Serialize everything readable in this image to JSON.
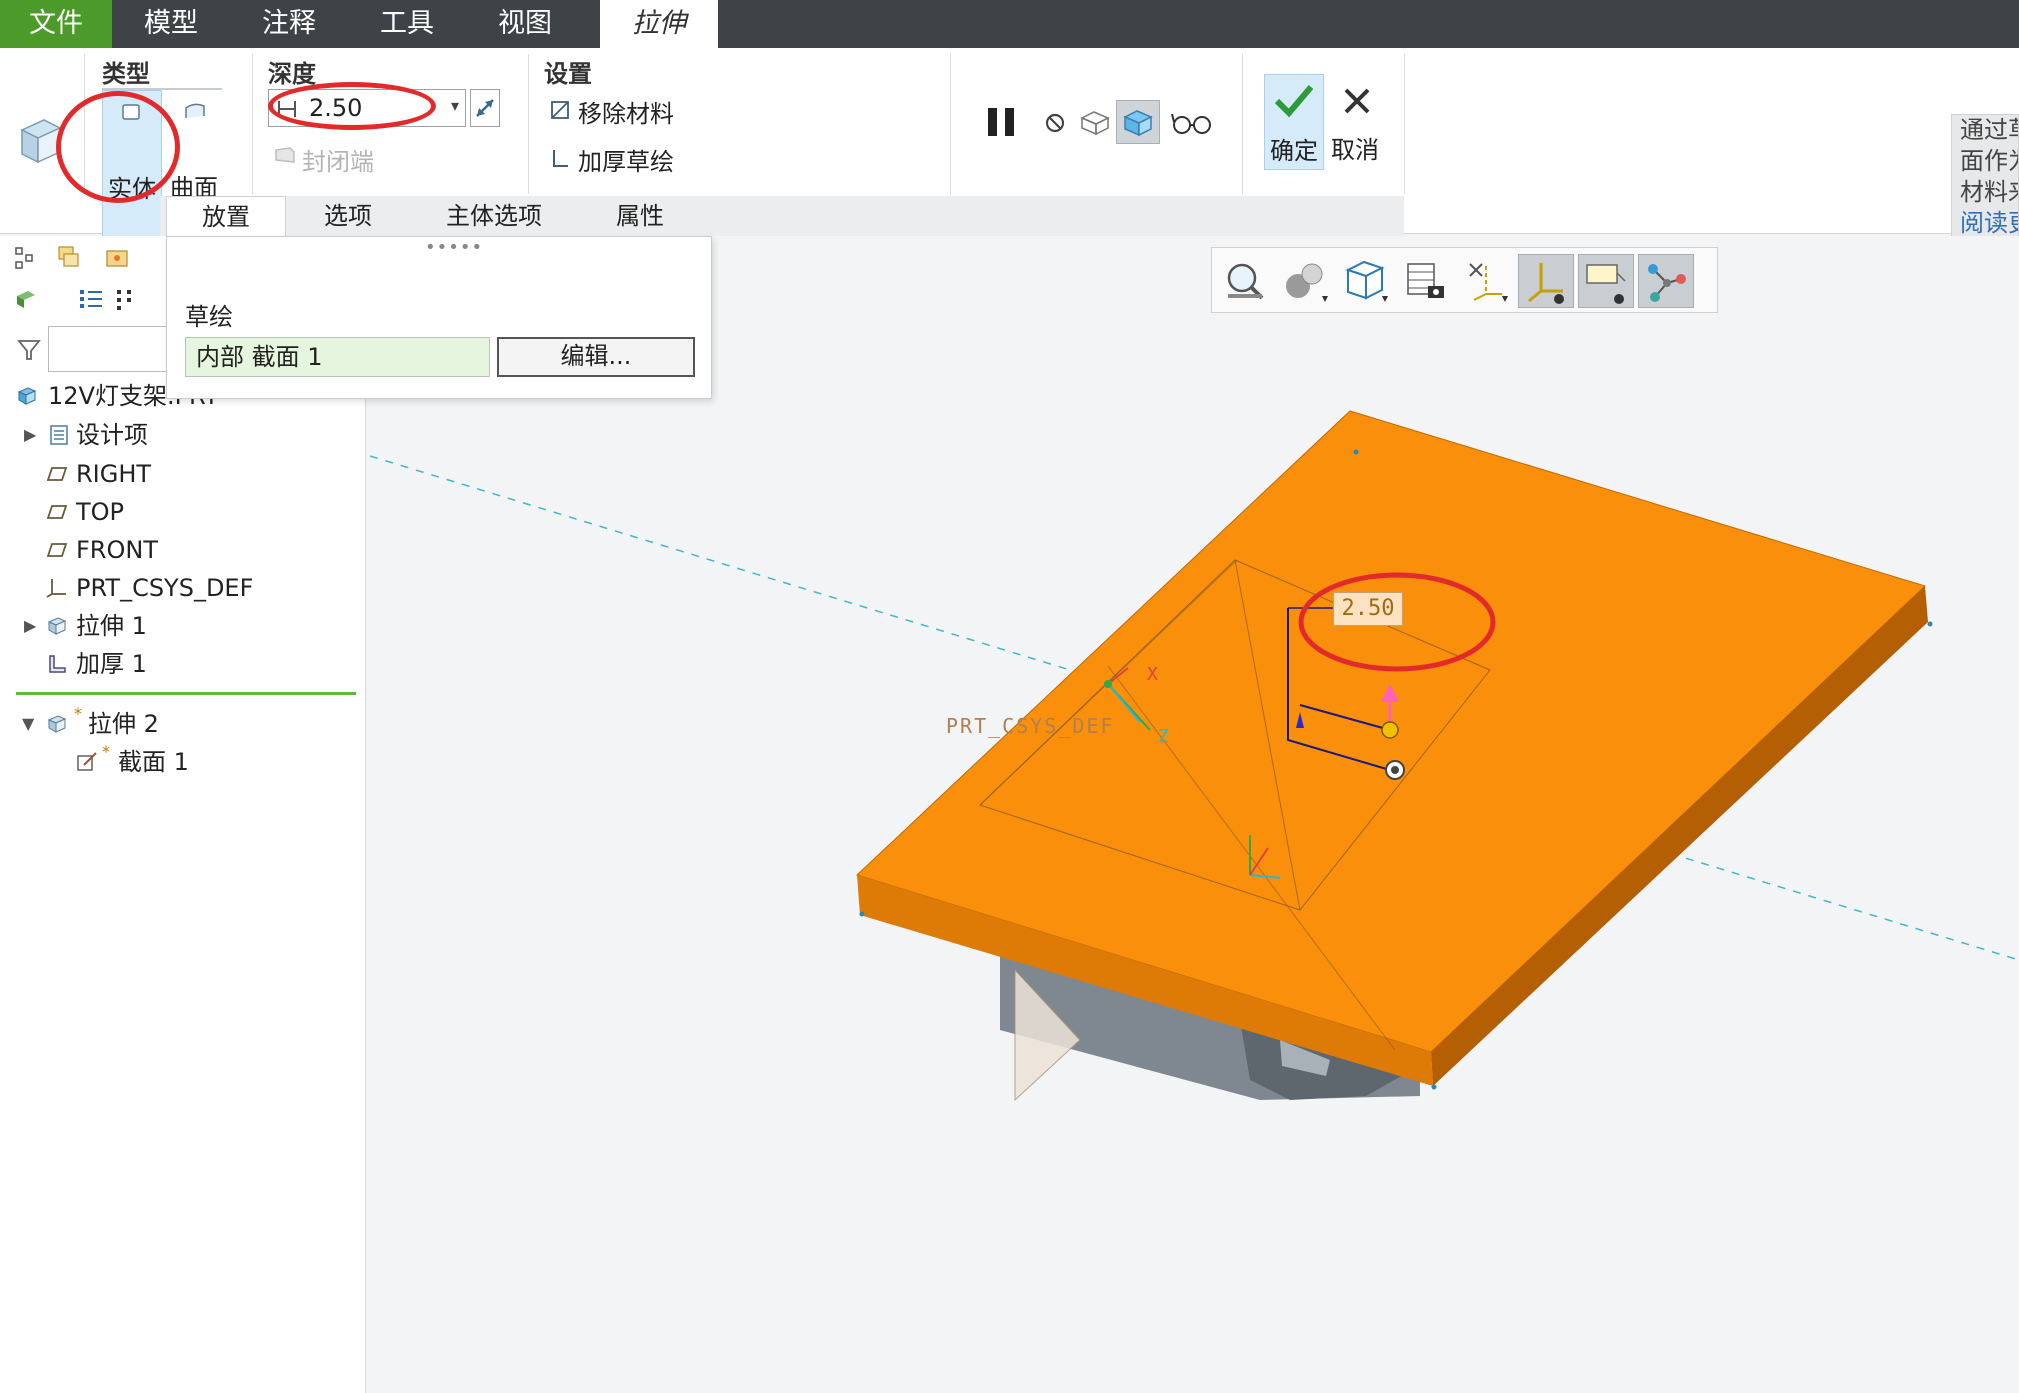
{
  "menubar": {
    "items": [
      {
        "label": "文件"
      },
      {
        "label": "模型"
      },
      {
        "label": "注释"
      },
      {
        "label": "工具"
      },
      {
        "label": "视图"
      },
      {
        "label": "拉伸"
      }
    ]
  },
  "ribbon": {
    "type_group": {
      "title": "类型",
      "solid_label": "实体",
      "surface_label": "曲面"
    },
    "depth_group": {
      "title": "深度",
      "value": "2.50",
      "capped_ends_label": "封闭端"
    },
    "settings_group": {
      "title": "设置",
      "remove_material_label": "移除材料",
      "thicken_sketch_label": "加厚草绘"
    },
    "confirm_label": "确定",
    "cancel_label": "取消",
    "tabs": [
      {
        "label": "放置"
      },
      {
        "label": "选项"
      },
      {
        "label": "主体选项"
      },
      {
        "label": "属性"
      }
    ],
    "right_tip": {
      "lines": [
        "通过草",
        "面作为",
        "材料来"
      ],
      "link": "阅读更"
    }
  },
  "placement_panel": {
    "sketch_label": "草绘",
    "section_value": "内部 截面 1",
    "edit_button": "编辑..."
  },
  "model_tree": {
    "root": "12V灯支架.PRT",
    "items": [
      {
        "label": "设计项"
      },
      {
        "label": "RIGHT"
      },
      {
        "label": "TOP"
      },
      {
        "label": "FRONT"
      },
      {
        "label": "PRT_CSYS_DEF"
      },
      {
        "label": "拉伸 1"
      },
      {
        "label": "加厚 1"
      }
    ],
    "inserted": [
      {
        "marker": "*",
        "label": "拉伸 2"
      },
      {
        "marker": "*",
        "label": "截面 1"
      }
    ]
  },
  "graphics": {
    "dimension_value": "2.50",
    "csys_label": "PRT_CSYS_DEF",
    "axis_z": "Z",
    "axis_x": "X",
    "colors": {
      "top_face": "#f98f0a",
      "front_face": "#de7a06",
      "side_face": "#b55f05",
      "base": "#8d949c"
    }
  },
  "accent": {
    "menu_green": "#4c9a2a",
    "annotation_red": "#e22a2a",
    "highlight_blue": "#d6ebfa"
  }
}
